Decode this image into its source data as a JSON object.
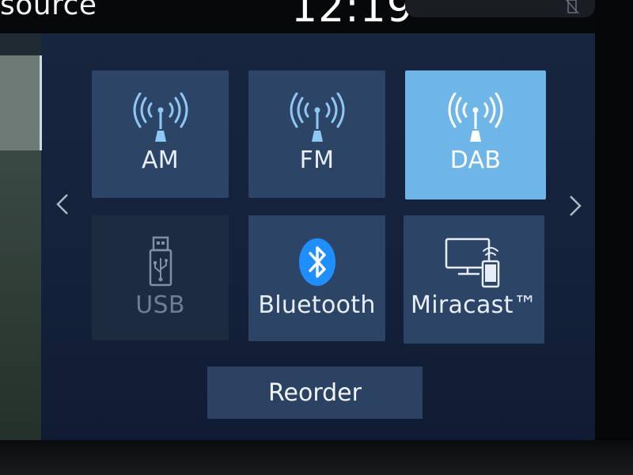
{
  "header": {
    "title": "source",
    "clock": "12:19"
  },
  "sources": [
    {
      "label": "AM",
      "icon": "antenna-icon",
      "state": "normal"
    },
    {
      "label": "FM",
      "icon": "antenna-icon",
      "state": "normal"
    },
    {
      "label": "DAB",
      "icon": "antenna-icon",
      "state": "selected"
    },
    {
      "label": "USB",
      "icon": "usb-icon",
      "state": "disabled"
    },
    {
      "label": "Bluetooth",
      "icon": "bluetooth-icon",
      "state": "normal"
    },
    {
      "label": "Miracast™",
      "icon": "miracast-icon",
      "state": "normal"
    }
  ],
  "actions": {
    "reorder_label": "Reorder"
  },
  "colors": {
    "tile": "#2c4567",
    "tile_selected": "#6eb6e8",
    "tile_disabled": "#1d2b3f",
    "accent_blue": "#1f8fff",
    "background": "#13213a"
  }
}
